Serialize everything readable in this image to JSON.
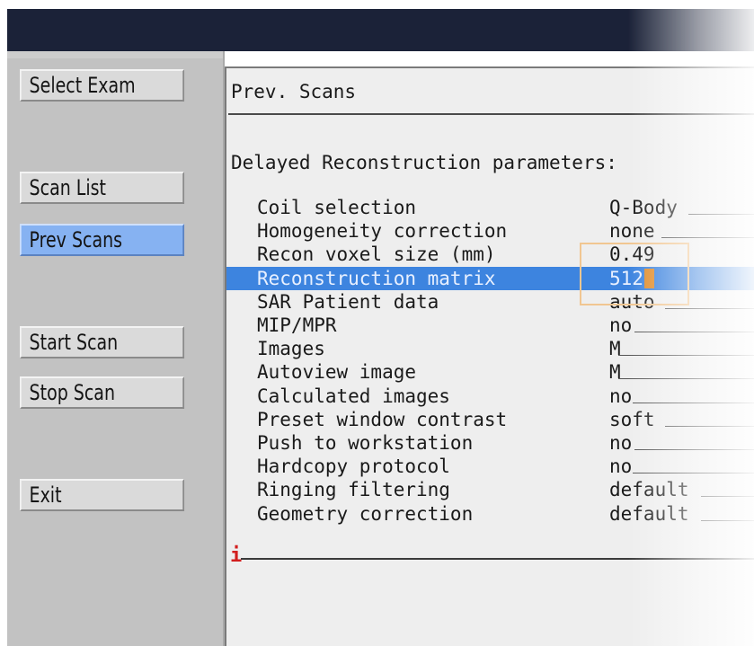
{
  "sidebar": {
    "buttons": [
      {
        "label": "Select Exam"
      },
      {
        "label": "Scan List"
      },
      {
        "label": "Prev Scans"
      },
      {
        "label": "Start Scan"
      },
      {
        "label": "Stop Scan"
      },
      {
        "label": "Exit"
      }
    ],
    "active": "Prev Scans"
  },
  "main": {
    "title": "Prev. Scans",
    "section_title": "Delayed Reconstruction parameters:",
    "parameters": [
      {
        "label": "Coil selection",
        "value": "Q-Body"
      },
      {
        "label": "Homogeneity correction",
        "value": "none"
      },
      {
        "label": "Recon voxel size (mm)",
        "value": "0.49"
      },
      {
        "label": "Reconstruction matrix",
        "value": "512"
      },
      {
        "label": "SAR Patient data",
        "value": "auto"
      },
      {
        "label": "MIP/MPR",
        "value": "no"
      },
      {
        "label": "Images",
        "value": "M"
      },
      {
        "label": "Autoview image",
        "value": "M"
      },
      {
        "label": "Calculated images",
        "value": "no"
      },
      {
        "label": "Preset window contrast",
        "value": "soft"
      },
      {
        "label": "Push to workstation",
        "value": "no"
      },
      {
        "label": "Hardcopy protocol",
        "value": "no"
      },
      {
        "label": "Ringing filtering",
        "value": "default"
      },
      {
        "label": "Geometry correction",
        "value": "default"
      }
    ],
    "selected_parameter": "Reconstruction matrix",
    "info_icon": "i"
  },
  "colors": {
    "titlebar": "#1b2238",
    "selection": "#3d84df",
    "active_button": "#86b2f2",
    "cursor": "#e08c2a",
    "info": "#d21e1e"
  }
}
